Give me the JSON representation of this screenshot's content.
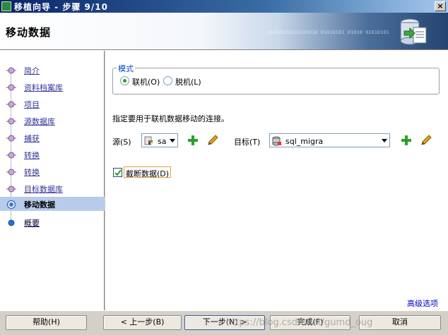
{
  "window": {
    "title": "移植向导 - 步骤 9/10",
    "close_glyph": "×"
  },
  "header": {
    "page_title": "移动数据",
    "binary_text": "01010101010101010 01010101 01010 01010101"
  },
  "sidebar": {
    "items": [
      {
        "label": "简介",
        "state": "done"
      },
      {
        "label": "资料档案库",
        "state": "done"
      },
      {
        "label": "项目",
        "state": "done"
      },
      {
        "label": "源数据库",
        "state": "done"
      },
      {
        "label": "捕获",
        "state": "done"
      },
      {
        "label": "转换",
        "state": "done"
      },
      {
        "label": "转换",
        "state": "done"
      },
      {
        "label": "目标数据库",
        "state": "done"
      },
      {
        "label": "移动数据",
        "state": "current"
      },
      {
        "label": "概要",
        "state": "future"
      }
    ]
  },
  "mode": {
    "legend": "模式",
    "options": [
      {
        "label": "联机(O)",
        "selected": true
      },
      {
        "label": "脱机(L)",
        "selected": false
      }
    ]
  },
  "description": "指定要用于联机数据移动的连接。",
  "source": {
    "label": "源(S)",
    "value": "sa",
    "icon": "database-connection-icon"
  },
  "target": {
    "label": "目标(T)",
    "value": "sql_migra",
    "icon": "database-connection-icon"
  },
  "truncate": {
    "label": "截断数据(D)",
    "checked": true
  },
  "advanced_link": "高级选项",
  "buttons": {
    "help": "帮助(H)",
    "back": "< 上一步(B)",
    "next": "下一步(N) >",
    "finish": "完成(F)",
    "cancel": "取消"
  },
  "watermark": "https://blog.csdn.net/gumd_oug",
  "colors": {
    "accent": "#0046d5",
    "selected_step": "#b7ccea",
    "add_icon": "#2aa02a",
    "link": "#333399"
  }
}
